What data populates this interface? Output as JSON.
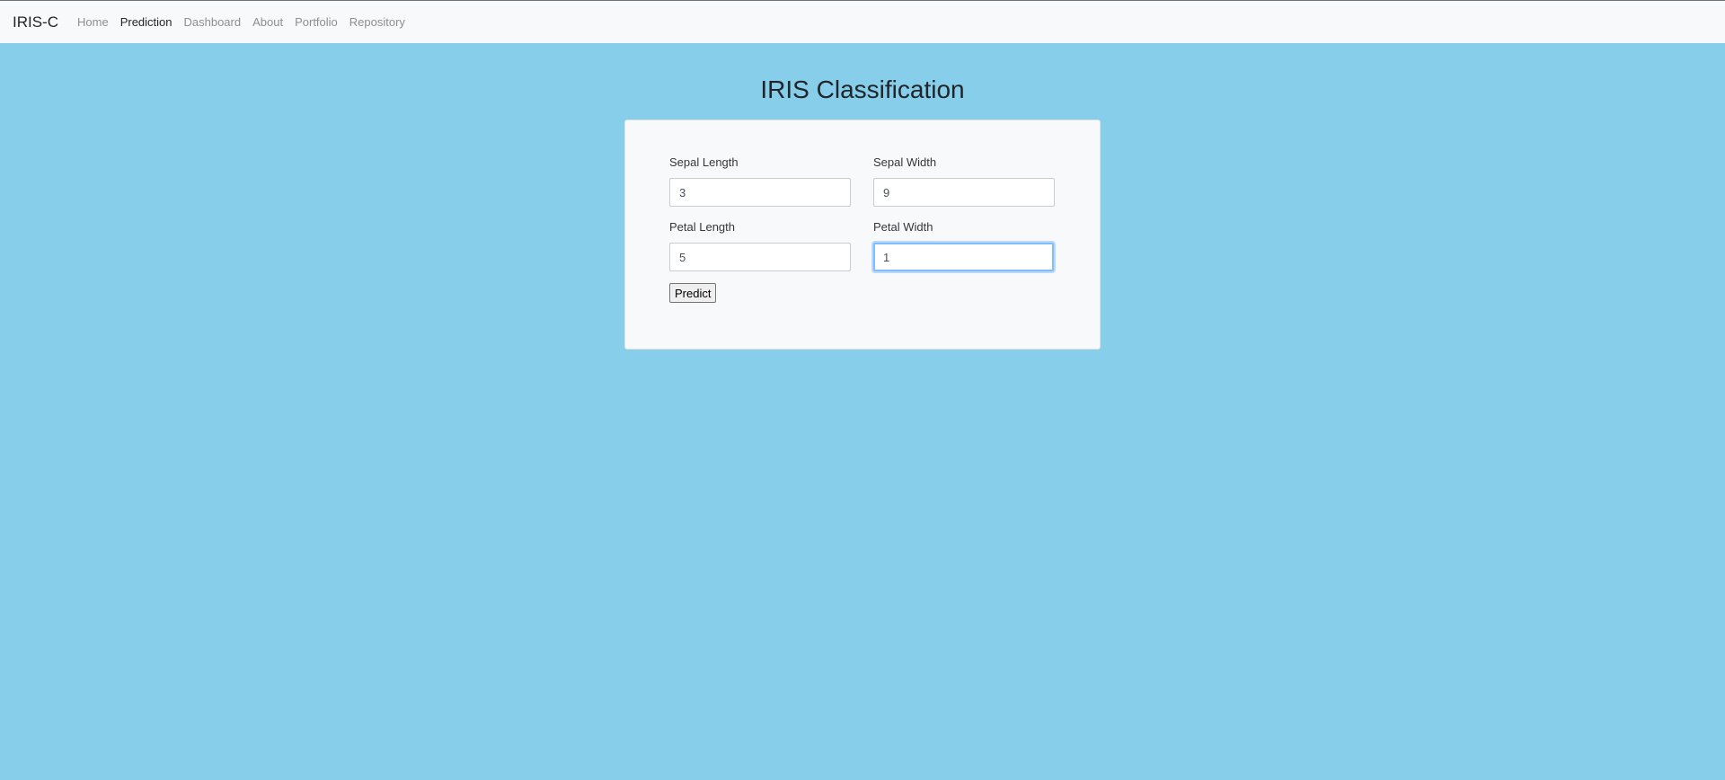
{
  "navbar": {
    "brand": "IRIS-C",
    "links": [
      {
        "label": "Home"
      },
      {
        "label": "Prediction"
      },
      {
        "label": "Dashboard"
      },
      {
        "label": "About"
      },
      {
        "label": "Portfolio"
      },
      {
        "label": "Repository"
      }
    ],
    "active": "Prediction"
  },
  "page": {
    "title": "IRIS Classification"
  },
  "form": {
    "sepal_length": {
      "label": "Sepal Length",
      "value": "3"
    },
    "sepal_width": {
      "label": "Sepal Width",
      "value": "9"
    },
    "petal_length": {
      "label": "Petal Length",
      "value": "5"
    },
    "petal_width": {
      "label": "Petal Width",
      "value": "1"
    },
    "submit_label": "Predict"
  },
  "colors": {
    "background": "#87CEEB",
    "card": "#f8f9fa",
    "focus_ring": "#80bdff"
  }
}
